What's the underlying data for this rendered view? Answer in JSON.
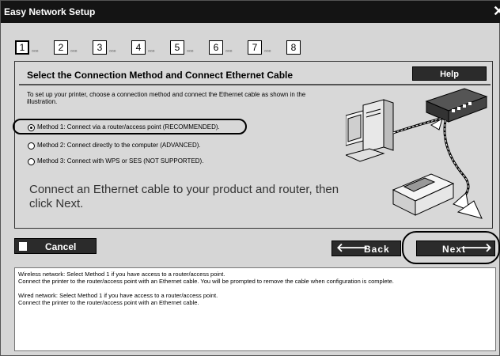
{
  "window": {
    "title": "Easy Network Setup",
    "close_label": "✕"
  },
  "steps": [
    {
      "number": "1",
      "active": true
    },
    {
      "number": "2",
      "active": false
    },
    {
      "number": "3",
      "active": false
    },
    {
      "number": "4",
      "active": false
    },
    {
      "number": "5",
      "active": false
    },
    {
      "number": "6",
      "active": false
    },
    {
      "number": "7",
      "active": false
    },
    {
      "number": "8",
      "active": false
    }
  ],
  "step_dots": "▫▫▫",
  "main": {
    "heading": "Select the Connection Method and Connect Ethernet Cable",
    "help_label": "Help",
    "intro": "To set up your printer, choose a connection method and connect the Ethernet cable as shown in the illustration.",
    "options": [
      {
        "label": "Method 1: Connect via a router/access point (RECOMMENDED).",
        "checked": true
      },
      {
        "label": "Method 2: Connect directly to the computer (ADVANCED).",
        "checked": false
      },
      {
        "label": "Method 3: Connect with WPS or SES (NOT SUPPORTED).",
        "checked": false
      }
    ],
    "instruction": "Connect an Ethernet cable to your product and router, then click Next."
  },
  "buttons": {
    "cancel_label": "Cancel",
    "back_label": "Back",
    "next_label": "Next",
    "back_arrow": "🡐",
    "next_arrow": "🡒"
  },
  "info": {
    "wireless_line1": "Wireless network: Select Method 1 if you have access to a router/access point.",
    "wireless_line2": "Connect the printer to the router/access point with an Ethernet cable. You will be prompted to remove the cable when configuration is complete.",
    "wired_line1": "Wired network: Select Method 1 if you have access to a router/access point.",
    "wired_line2": "Connect the printer to the router/access point with an Ethernet cable."
  },
  "colors": {
    "titlebar": "#141414",
    "button_dark": "#2b2b2b",
    "panel_bg": "#d8d8d8"
  }
}
